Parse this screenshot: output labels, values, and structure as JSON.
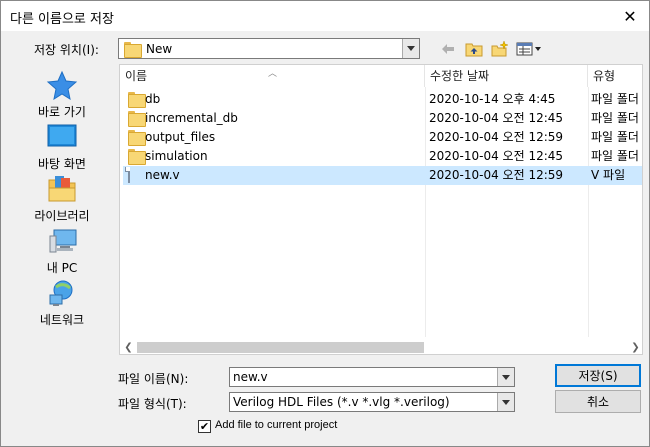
{
  "dialog": {
    "title": "다른 이름으로 저장",
    "close_glyph": "✕"
  },
  "location": {
    "label": "저장 위치(I):",
    "value": "New"
  },
  "toolbar": {
    "back_icon": "back-arrow-icon",
    "up_icon": "up-folder-icon",
    "new_folder_icon": "new-folder-icon",
    "view_icon": "view-menu-icon"
  },
  "places": [
    {
      "label": "바로 가기",
      "icon": "star-icon"
    },
    {
      "label": "바탕 화면",
      "icon": "desktop-icon"
    },
    {
      "label": "라이브러리",
      "icon": "libraries-icon"
    },
    {
      "label": "내 PC",
      "icon": "pc-icon"
    },
    {
      "label": "네트워크",
      "icon": "network-icon"
    }
  ],
  "columns": {
    "name": "이름",
    "date": "수정한 날짜",
    "type": "유형"
  },
  "files": [
    {
      "name": "db",
      "date": "2020-10-14 오후 4:45",
      "type": "파일 폴더",
      "kind": "folder"
    },
    {
      "name": "incremental_db",
      "date": "2020-10-04 오전 12:45",
      "type": "파일 폴더",
      "kind": "folder"
    },
    {
      "name": "output_files",
      "date": "2020-10-04 오전 12:59",
      "type": "파일 폴더",
      "kind": "folder"
    },
    {
      "name": "simulation",
      "date": "2020-10-04 오전 12:45",
      "type": "파일 폴더",
      "kind": "folder"
    },
    {
      "name": "new.v",
      "date": "2020-10-04 오전 12:59",
      "type": "V 파일",
      "kind": "file",
      "selected": true
    }
  ],
  "filename": {
    "label": "파일 이름(N):",
    "value": "new.v"
  },
  "filetype": {
    "label": "파일 형식(T):",
    "value": "Verilog HDL Files (*.v *.vlg *.verilog)"
  },
  "buttons": {
    "save": "저장(S)",
    "cancel": "취소"
  },
  "add_to_project": {
    "label": "Add file to current project",
    "checked": true,
    "check_glyph": "✔"
  },
  "colors": {
    "selection": "#cce8ff",
    "accent": "#0078d7"
  }
}
